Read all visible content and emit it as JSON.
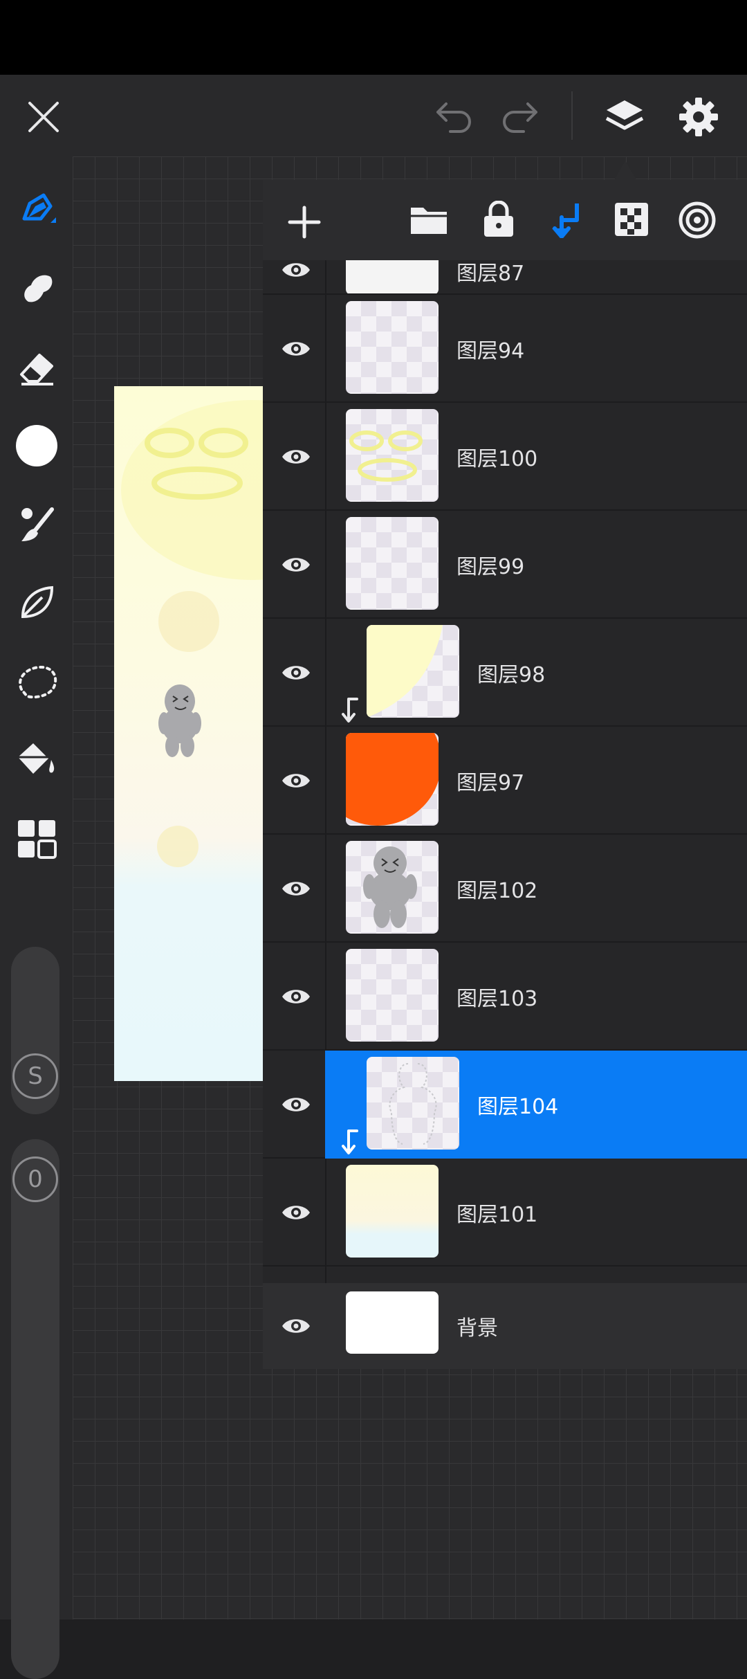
{
  "colors": {
    "accent": "#0a7cf5",
    "toolbar_bg": "#29292b",
    "panel_bg": "#262628",
    "orange": "#ff5a0a"
  },
  "toolbar": {
    "tools": [
      "brush-icon",
      "smudge-icon",
      "eraser-icon",
      "color-icon",
      "brush-library-icon",
      "liquify-icon",
      "selection-icon",
      "fill-icon",
      "apps-icon"
    ],
    "size_slider_label": "S",
    "opacity_slider_label": "0"
  },
  "layers_panel": {
    "header_icons": [
      "add-icon",
      "folder-icon",
      "lock-icon",
      "clipping-icon",
      "alpha-lock-icon",
      "blend-icon"
    ],
    "layers": [
      {
        "name": "图层87",
        "visible": true,
        "clipped": false,
        "selected": false
      },
      {
        "name": "图层94",
        "visible": true,
        "clipped": false,
        "selected": false
      },
      {
        "name": "图层100",
        "visible": true,
        "clipped": false,
        "selected": false
      },
      {
        "name": "图层99",
        "visible": true,
        "clipped": false,
        "selected": false
      },
      {
        "name": "图层98",
        "visible": true,
        "clipped": true,
        "selected": false
      },
      {
        "name": "图层97",
        "visible": true,
        "clipped": false,
        "selected": false
      },
      {
        "name": "图层102",
        "visible": true,
        "clipped": false,
        "selected": false
      },
      {
        "name": "图层103",
        "visible": true,
        "clipped": false,
        "selected": false
      },
      {
        "name": "图层104",
        "visible": true,
        "clipped": true,
        "selected": true
      },
      {
        "name": "图层101",
        "visible": true,
        "clipped": false,
        "selected": false
      }
    ],
    "background_layer": {
      "name": "背景",
      "visible": true
    }
  }
}
